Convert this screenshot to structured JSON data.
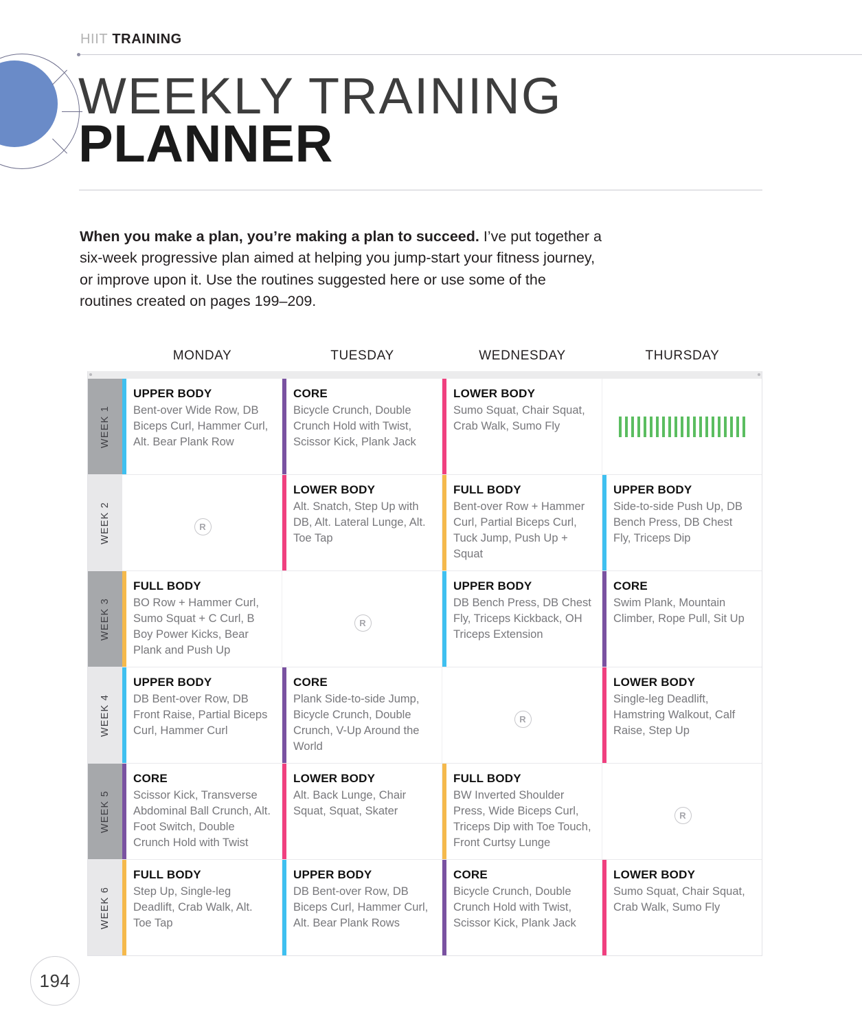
{
  "brand": {
    "kicker_light": "HIIT",
    "kicker_bold": "TRAINING",
    "logo_icon": "circle-target-icon"
  },
  "header": {
    "title_line1": "WEEKLY TRAINING",
    "title_line2": "PLANNER"
  },
  "intro": {
    "lead": "When you make a plan, you’re making a plan to succeed.",
    "rest": " I’ve put together a six-week progressive plan aimed at helping you jump-start your fitness journey, or improve upon it. Use the routines suggested here or use some of the routines created on pages 199–209."
  },
  "colors": {
    "blue": "#3fc0f0",
    "purple": "#7a52a1",
    "pink": "#f0407f",
    "orange": "#f2b council",
    "orange_hex": "#f5b94c",
    "green": "#5bbd60",
    "week_dark": "#a6a8ab",
    "week_light": "#e8e8ea"
  },
  "planner": {
    "days": [
      "MONDAY",
      "TUESDAY",
      "WEDNESDAY",
      "THURSDAY"
    ],
    "rest_label": "R",
    "weeks": [
      {
        "label": "WEEK 1",
        "shade": "dark",
        "cells": [
          {
            "type": "workout",
            "accent": "#3fc0f0",
            "title": "UPPER BODY",
            "body": "Bent-over Wide Row, DB Biceps Curl, Hammer Curl, Alt. Bear Plank Row"
          },
          {
            "type": "workout",
            "accent": "#7a52a1",
            "title": "CORE",
            "body": "Bicycle Crunch, Double Crunch Hold with Twist, Scissor Kick, Plank Jack"
          },
          {
            "type": "workout",
            "accent": "#f0407f",
            "title": "LOWER BODY",
            "body": "Sumo Squat, Chair Squat, Crab Walk, Sumo Fly"
          },
          {
            "type": "barcode",
            "accent": "",
            "title": "",
            "body": ""
          }
        ]
      },
      {
        "label": "WEEK 2",
        "shade": "light",
        "cells": [
          {
            "type": "rest",
            "accent": "",
            "title": "",
            "body": ""
          },
          {
            "type": "workout",
            "accent": "#f0407f",
            "title": "LOWER BODY",
            "body": "Alt. Snatch, Step Up with DB, Alt. Lateral Lunge, Alt. Toe Tap"
          },
          {
            "type": "workout",
            "accent": "#f5b94c",
            "title": "FULL BODY",
            "body": "Bent-over Row + Hammer Curl, Partial Biceps Curl, Tuck Jump, Push Up + Squat"
          },
          {
            "type": "workout",
            "accent": "#3fc0f0",
            "title": "UPPER BODY",
            "body": "Side-to-side Push Up, DB Bench Press, DB Chest Fly, Triceps Dip"
          }
        ]
      },
      {
        "label": "WEEK 3",
        "shade": "dark",
        "cells": [
          {
            "type": "workout",
            "accent": "#f5b94c",
            "title": "FULL BODY",
            "body": "BO Row + Hammer Curl, Sumo Squat + C Curl, B Boy Power Kicks, Bear Plank and Push Up"
          },
          {
            "type": "rest",
            "accent": "",
            "title": "",
            "body": ""
          },
          {
            "type": "workout",
            "accent": "#3fc0f0",
            "title": "UPPER BODY",
            "body": "DB Bench Press, DB Chest Fly, Triceps Kickback, OH Triceps Extension"
          },
          {
            "type": "workout",
            "accent": "#7a52a1",
            "title": "CORE",
            "body": "Swim Plank, Mountain Climber, Rope Pull, Sit Up"
          }
        ]
      },
      {
        "label": "WEEK 4",
        "shade": "light",
        "cells": [
          {
            "type": "workout",
            "accent": "#3fc0f0",
            "title": "UPPER BODY",
            "body": "DB Bent-over Row, DB Front Raise, Partial Biceps Curl, Hammer Curl"
          },
          {
            "type": "workout",
            "accent": "#7a52a1",
            "title": "CORE",
            "body": "Plank Side-to-side Jump, Bicycle Crunch, Double Crunch, V-Up Around the World"
          },
          {
            "type": "rest",
            "accent": "",
            "title": "",
            "body": ""
          },
          {
            "type": "workout",
            "accent": "#f0407f",
            "title": "LOWER BODY",
            "body": "Single-leg Deadlift, Hamstring Walkout, Calf Raise, Step Up"
          }
        ]
      },
      {
        "label": "WEEK 5",
        "shade": "dark",
        "cells": [
          {
            "type": "workout",
            "accent": "#7a52a1",
            "title": "CORE",
            "body": "Scissor Kick, Transverse Abdominal Ball Crunch, Alt. Foot Switch, Double Crunch Hold with Twist"
          },
          {
            "type": "workout",
            "accent": "#f0407f",
            "title": "LOWER BODY",
            "body": "Alt. Back Lunge, Chair Squat, Squat, Skater"
          },
          {
            "type": "workout",
            "accent": "#f5b94c",
            "title": "FULL BODY",
            "body": "BW Inverted Shoulder Press, Wide Biceps Curl, Triceps Dip with Toe Touch, Front Curtsy Lunge"
          },
          {
            "type": "rest",
            "accent": "",
            "title": "",
            "body": ""
          }
        ]
      },
      {
        "label": "WEEK 6",
        "shade": "light",
        "cells": [
          {
            "type": "workout",
            "accent": "#f5b94c",
            "title": "FULL BODY",
            "body": "Step Up, Single-leg Deadlift, Crab Walk, Alt. Toe Tap"
          },
          {
            "type": "workout",
            "accent": "#3fc0f0",
            "title": "UPPER BODY",
            "body": "DB Bent-over Row, DB Biceps Curl, Hammer Curl, Alt. Bear Plank Rows"
          },
          {
            "type": "workout",
            "accent": "#7a52a1",
            "title": "CORE",
            "body": "Bicycle Crunch, Double Crunch Hold with Twist, Scissor Kick, Plank Jack"
          },
          {
            "type": "workout",
            "accent": "#f0407f",
            "title": "LOWER BODY",
            "body": "Sumo Squat, Chair Squat, Crab Walk, Sumo Fly"
          }
        ]
      }
    ]
  },
  "footer": {
    "page_number": "194"
  }
}
